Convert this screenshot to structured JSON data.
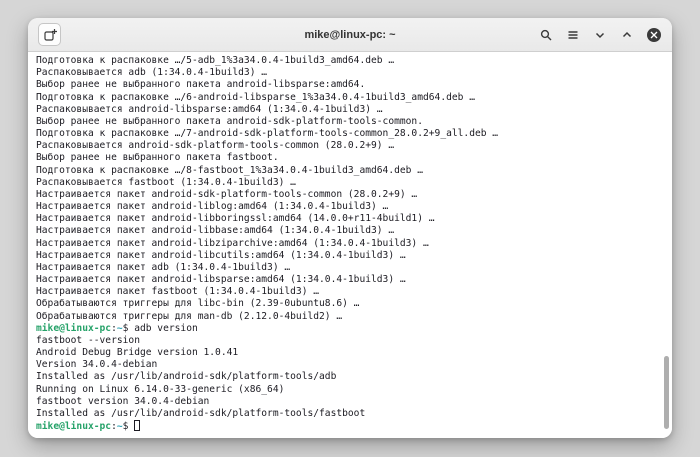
{
  "window": {
    "title": "mike@linux-pc: ~"
  },
  "titlebar": {
    "buttons": [
      "new-tab",
      "search",
      "menu",
      "minimize",
      "maximize",
      "close"
    ]
  },
  "colors": {
    "prompt_user_green": "#26a269",
    "prompt_path_teal": "#2aa1b3",
    "terminal_foreground": "#1c1b22",
    "terminal_background": "#ffffff",
    "titlebar_background": "#ebebeb",
    "desktop_background": "#d6d6d6",
    "close_button_background": "#3a3a3a",
    "scrollbar_thumb": "#aeaeae"
  },
  "terminal": {
    "lines": [
      {
        "segments": [
          {
            "text": "Подготовка к распаковке …/5-adb_1%3a34.0.4-1build3_amd64.deb …"
          }
        ]
      },
      {
        "segments": [
          {
            "text": "Распаковывается adb (1:34.0.4-1build3) …"
          }
        ]
      },
      {
        "segments": [
          {
            "text": "Выбор ранее не выбранного пакета android-libsparse:amd64."
          }
        ]
      },
      {
        "segments": [
          {
            "text": "Подготовка к распаковке …/6-android-libsparse_1%3a34.0.4-1build3_amd64.deb …"
          }
        ]
      },
      {
        "segments": [
          {
            "text": "Распаковывается android-libsparse:amd64 (1:34.0.4-1build3) …"
          }
        ]
      },
      {
        "segments": [
          {
            "text": "Выбор ранее не выбранного пакета android-sdk-platform-tools-common."
          }
        ]
      },
      {
        "segments": [
          {
            "text": "Подготовка к распаковке …/7-android-sdk-platform-tools-common_28.0.2+9_all.deb …"
          }
        ]
      },
      {
        "segments": [
          {
            "text": "Распаковывается android-sdk-platform-tools-common (28.0.2+9) …"
          }
        ]
      },
      {
        "segments": [
          {
            "text": "Выбор ранее не выбранного пакета fastboot."
          }
        ]
      },
      {
        "segments": [
          {
            "text": "Подготовка к распаковке …/8-fastboot_1%3a34.0.4-1build3_amd64.deb …"
          }
        ]
      },
      {
        "segments": [
          {
            "text": "Распаковывается fastboot (1:34.0.4-1build3) …"
          }
        ]
      },
      {
        "segments": [
          {
            "text": "Настраивается пакет android-sdk-platform-tools-common (28.0.2+9) …"
          }
        ]
      },
      {
        "segments": [
          {
            "text": "Настраивается пакет android-liblog:amd64 (1:34.0.4-1build3) …"
          }
        ]
      },
      {
        "segments": [
          {
            "text": "Настраивается пакет android-libboringssl:amd64 (14.0.0+r11-4build1) …"
          }
        ]
      },
      {
        "segments": [
          {
            "text": "Настраивается пакет android-libbase:amd64 (1:34.0.4-1build3) …"
          }
        ]
      },
      {
        "segments": [
          {
            "text": "Настраивается пакет android-libziparchive:amd64 (1:34.0.4-1build3) …"
          }
        ]
      },
      {
        "segments": [
          {
            "text": "Настраивается пакет android-libcutils:amd64 (1:34.0.4-1build3) …"
          }
        ]
      },
      {
        "segments": [
          {
            "text": "Настраивается пакет adb (1:34.0.4-1build3) …"
          }
        ]
      },
      {
        "segments": [
          {
            "text": "Настраивается пакет android-libsparse:amd64 (1:34.0.4-1build3) …"
          }
        ]
      },
      {
        "segments": [
          {
            "text": "Настраивается пакет fastboot (1:34.0.4-1build3) …"
          }
        ]
      },
      {
        "segments": [
          {
            "text": "Обрабатываются триггеры для libc-bin (2.39-0ubuntu8.6) …"
          }
        ]
      },
      {
        "segments": [
          {
            "text": "Обрабатываются триггеры для man-db (2.12.0-4build2) …"
          }
        ]
      },
      {
        "segments": [
          {
            "text": "mike@linux-pc",
            "color": "user"
          },
          {
            "text": ":"
          },
          {
            "text": "~",
            "color": "path"
          },
          {
            "text": "$ adb version"
          }
        ]
      },
      {
        "segments": [
          {
            "text": "fastboot --version"
          }
        ]
      },
      {
        "segments": [
          {
            "text": "Android Debug Bridge version 1.0.41"
          }
        ]
      },
      {
        "segments": [
          {
            "text": "Version 34.0.4-debian"
          }
        ]
      },
      {
        "segments": [
          {
            "text": "Installed as /usr/lib/android-sdk/platform-tools/adb"
          }
        ]
      },
      {
        "segments": [
          {
            "text": "Running on Linux 6.14.0-33-generic (x86_64)"
          }
        ]
      },
      {
        "segments": [
          {
            "text": "fastboot version 34.0.4-debian"
          }
        ]
      },
      {
        "segments": [
          {
            "text": "Installed as /usr/lib/android-sdk/platform-tools/fastboot"
          }
        ]
      },
      {
        "segments": [
          {
            "text": "mike@linux-pc",
            "color": "user"
          },
          {
            "text": ":"
          },
          {
            "text": "~",
            "color": "path"
          },
          {
            "text": "$ "
          }
        ],
        "cursor": true
      }
    ]
  }
}
